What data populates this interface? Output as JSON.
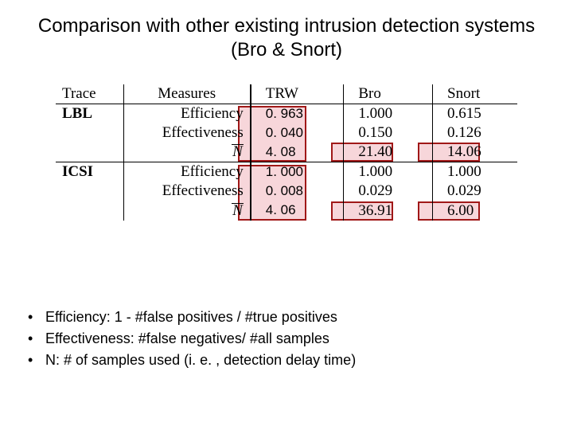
{
  "title": "Comparison with other existing intrusion detection systems (Bro & Snort)",
  "table": {
    "headers": {
      "trace": "Trace",
      "measures": "Measures",
      "trw": "TRW",
      "bro": "Bro",
      "snort": "Snort"
    },
    "measures": {
      "efficiency": "Efficiency",
      "effectiveness": "Effectiveness",
      "nbar": "N"
    },
    "rows": [
      {
        "trace": "LBL",
        "trw": {
          "efficiency": "0. 963",
          "effectiveness": "0. 040",
          "nbar": "4. 08"
        },
        "bro": {
          "efficiency": "1.000",
          "effectiveness": "0.150",
          "nbar": "21.40"
        },
        "snort": {
          "efficiency": "0.615",
          "effectiveness": "0.126",
          "nbar": "14.06"
        }
      },
      {
        "trace": "ICSI",
        "trw": {
          "efficiency": "1. 000",
          "effectiveness": "0. 008",
          "nbar": "4. 06"
        },
        "bro": {
          "efficiency": "1.000",
          "effectiveness": "0.029",
          "nbar": "36.91"
        },
        "snort": {
          "efficiency": "1.000",
          "effectiveness": "0.029",
          "nbar": "6.00"
        }
      }
    ]
  },
  "bullets": [
    "Efficiency: 1 - #false positives / #true positives",
    "Effectiveness: #false negatives/ #all samples",
    "N: # of samples used (i. e. , detection delay time)"
  ]
}
